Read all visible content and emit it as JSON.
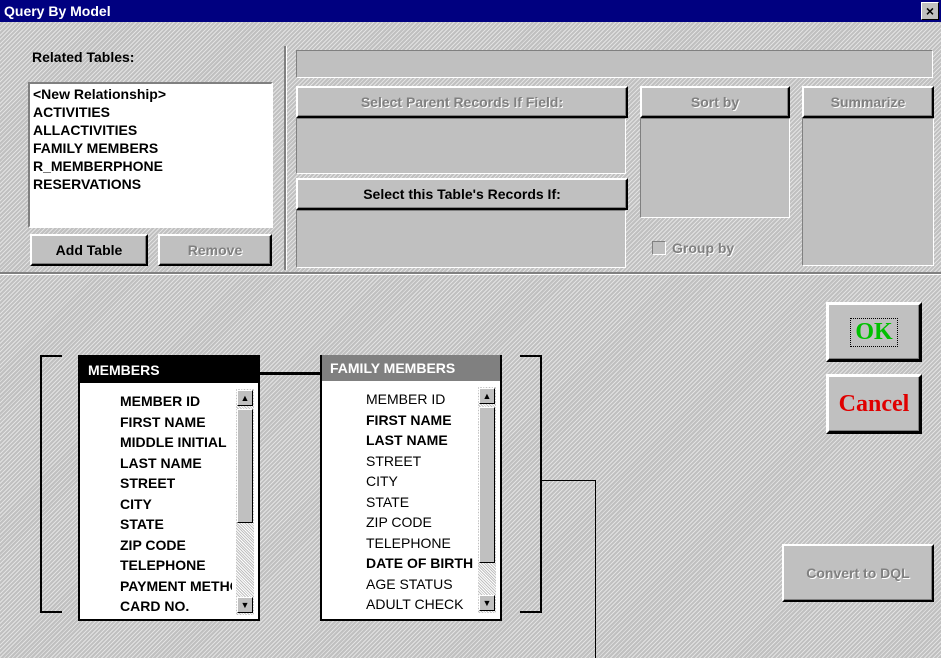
{
  "window": {
    "title": "Query By Model",
    "close_glyph": "×"
  },
  "related_tables": {
    "label": "Related Tables:",
    "items": [
      "<New Relationship>",
      "ACTIVITIES",
      "ALLACTIVITIES",
      "FAMILY MEMBERS",
      "R_MEMBERPHONE",
      "RESERVATIONS"
    ],
    "add_table": "Add Table",
    "remove": "Remove"
  },
  "criteria": {
    "select_parent": "Select Parent Records If Field:",
    "sort_by": "Sort by",
    "summarize": "Summarize",
    "select_this": "Select this Table's Records If:",
    "group_by": "Group by"
  },
  "buttons": {
    "ok": "OK",
    "cancel": "Cancel",
    "convert": "Convert to DQL"
  },
  "tables": {
    "members": {
      "title": "MEMBERS",
      "fields": [
        "MEMBER ID",
        "FIRST NAME",
        "MIDDLE INITIAL",
        "LAST NAME",
        "STREET",
        "CITY",
        "STATE",
        "ZIP CODE",
        "TELEPHONE",
        "PAYMENT METHOD",
        "CARD NO."
      ]
    },
    "family_members": {
      "title": "FAMILY MEMBERS",
      "fields": [
        "MEMBER ID",
        "FIRST NAME",
        "LAST NAME",
        "STREET",
        "CITY",
        "STATE",
        "ZIP CODE",
        "TELEPHONE",
        "DATE OF BIRTH",
        "AGE STATUS",
        "ADULT CHECK"
      ]
    }
  },
  "colors": {
    "title_bar": "#000080",
    "ok_text": "#00c000",
    "cancel_text": "#e00000",
    "members_header": "#000000",
    "family_header": "#808080"
  }
}
